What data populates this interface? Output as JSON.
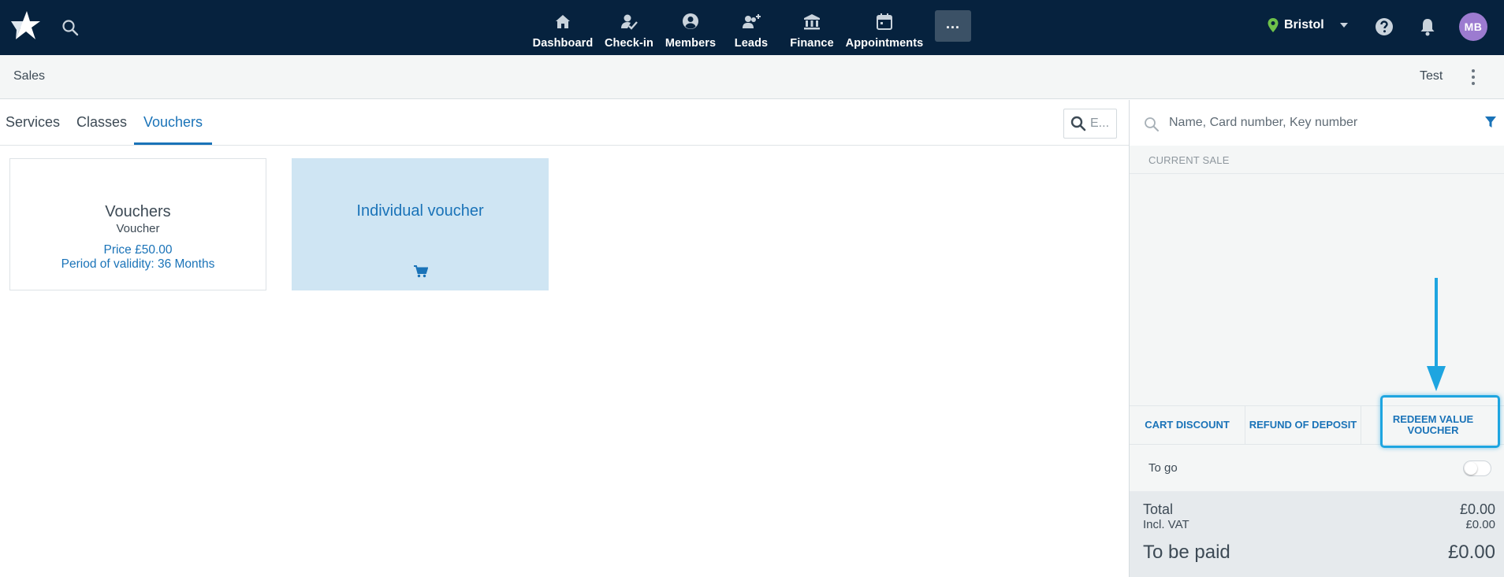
{
  "topbar": {
    "nav": [
      {
        "label": "Dashboard",
        "icon": "home-icon"
      },
      {
        "label": "Check-in",
        "icon": "user-check-icon"
      },
      {
        "label": "Members",
        "icon": "user-circle-icon"
      },
      {
        "label": "Leads",
        "icon": "user-add-icon"
      },
      {
        "label": "Finance",
        "icon": "bank-icon"
      },
      {
        "label": "Appointments",
        "icon": "calendar-icon"
      }
    ],
    "more_label": "...",
    "location": "Bristol",
    "avatar_initials": "MB"
  },
  "subheader": {
    "title": "Sales",
    "test_label": "Test"
  },
  "tabs": [
    {
      "label": "Services",
      "active": false
    },
    {
      "label": "Classes",
      "active": false
    },
    {
      "label": "Vouchers",
      "active": true
    }
  ],
  "search": {
    "placeholder": "E..."
  },
  "products": [
    {
      "title": "Vouchers",
      "subtitle": "Voucher",
      "price": "Price £50.00",
      "validity": "Period of validity: 36 Months"
    },
    {
      "title": "Individual voucher"
    }
  ],
  "sale_panel": {
    "search_placeholder": "Name, Card number, Key number",
    "current_sale_label": "CURRENT SALE",
    "actions": [
      {
        "label": "CART DISCOUNT"
      },
      {
        "label": "REFUND OF DEPOSIT"
      },
      {
        "label": "REDEEM VALUE VOUCHER"
      }
    ],
    "to_go_label": "To go",
    "to_go_enabled": false,
    "total_label": "Total",
    "total_value": "£0.00",
    "vat_label": "Incl. VAT",
    "vat_value": "£0.00",
    "to_be_paid_label": "To be paid",
    "to_be_paid_value": "£0.00"
  },
  "colors": {
    "topbar": "#06223e",
    "accent": "#1a73b8",
    "highlight": "#1ea5e0",
    "card_selected": "#cfe5f3",
    "avatar": "#9c7bd0",
    "location_pin": "#6ec14a"
  }
}
